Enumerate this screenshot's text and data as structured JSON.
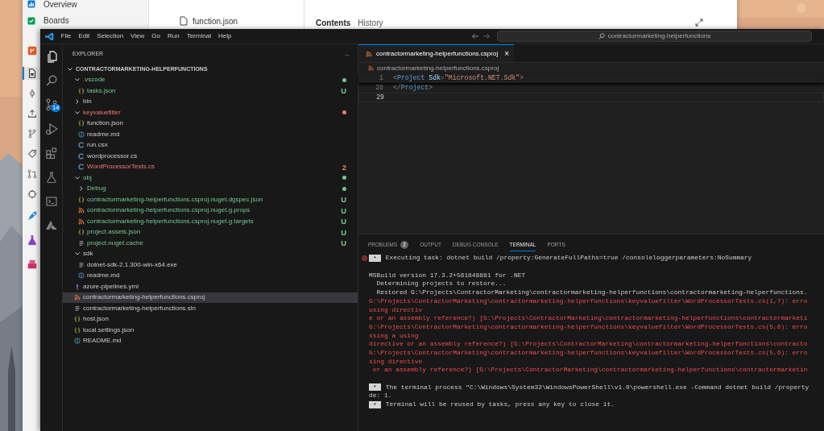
{
  "browser": {
    "nav": [
      {
        "kind": "overview",
        "label": "Overview",
        "selected": false
      },
      {
        "kind": "boards",
        "label": "Boards",
        "selected": false
      },
      {
        "kind": "repos",
        "selected": false
      },
      {
        "kind": "files",
        "selected": true
      },
      {
        "kind": "commits",
        "selected": false
      },
      {
        "kind": "pushes",
        "selected": false
      },
      {
        "kind": "branches",
        "selected": false
      },
      {
        "kind": "tags",
        "selected": false
      },
      {
        "kind": "pulls",
        "selected": false
      },
      {
        "kind": "advanced",
        "selected": false
      },
      {
        "kind": "pipelines",
        "selected": false
      },
      {
        "kind": "tests",
        "selected": false
      },
      {
        "kind": "artifacts",
        "selected": false
      }
    ],
    "file_tree": [
      {
        "name": "function.json"
      }
    ],
    "tabs": [
      {
        "label": "Contents",
        "selected": true
      },
      {
        "label": "History",
        "selected": false
      }
    ]
  },
  "editor": {
    "menu": [
      "File",
      "Edit",
      "Selection",
      "View",
      "Go",
      "Run",
      "Terminal",
      "Help"
    ],
    "command_center": "contractormarketing-helperfunctions",
    "activity_bar": [
      {
        "kind": "explorer",
        "selected": true
      },
      {
        "kind": "search",
        "selected": false
      },
      {
        "kind": "source-control",
        "badge": "14",
        "selected": false
      },
      {
        "kind": "run",
        "selected": false
      },
      {
        "kind": "extensions",
        "selected": false
      },
      {
        "kind": "testing",
        "selected": false
      },
      {
        "kind": "terminal",
        "selected": false
      },
      {
        "kind": "azure",
        "selected": false
      }
    ],
    "explorer": {
      "title": "EXPLORER",
      "more": "...",
      "root": {
        "name": "CONTRACTORMARKETING-HELPERFUNCTIONS",
        "expanded": true,
        "children": [
          {
            "name": ".vscode",
            "kind": "folder",
            "expanded": true,
            "color": "#73c991",
            "dot": true,
            "selected": false,
            "children": [
              {
                "name": "tasks.json",
                "kind": "json",
                "color": "#73c991",
                "decoration": "U",
                "selected": false
              }
            ]
          },
          {
            "name": "bin",
            "kind": "folder",
            "expanded": false,
            "dot": false,
            "selected": false
          },
          {
            "name": "keyvaluefilter",
            "kind": "folder",
            "expanded": true,
            "color": "#f07b6e",
            "dot": true,
            "selected": false,
            "children": [
              {
                "name": "function.json",
                "kind": "json",
                "selected": false
              },
              {
                "name": "readme.md",
                "kind": "info",
                "selected": false
              },
              {
                "name": "run.csx",
                "kind": "csharp",
                "selected": false
              },
              {
                "name": "wordprocessor.cs",
                "kind": "csharp",
                "selected": false
              },
              {
                "name": "WordProcessorTests.cs",
                "kind": "csharp",
                "color": "#f07b6e",
                "decoration": "2",
                "selected": false
              }
            ]
          },
          {
            "name": "obj",
            "kind": "folder",
            "expanded": true,
            "color": "#73c991",
            "dot": true,
            "selected": false,
            "children": [
              {
                "name": "Debug",
                "kind": "folder",
                "expanded": false,
                "color": "#73c991",
                "dot": true,
                "selected": false
              },
              {
                "name": "contractormarketing-helperfunctions.csproj.nuget.dgspec.json",
                "kind": "json",
                "color": "#73c991",
                "decoration": "U",
                "selected": false
              },
              {
                "name": "contractormarketing-helperfunctions.csproj.nuget.g.props",
                "kind": "rss",
                "color": "#73c991",
                "decoration": "U",
                "selected": false
              },
              {
                "name": "contractormarketing-helperfunctions.csproj.nuget.g.targets",
                "kind": "rss",
                "color": "#73c991",
                "decoration": "U",
                "selected": false
              },
              {
                "name": "project.assets.json",
                "kind": "json",
                "color": "#73c991",
                "decoration": "U",
                "selected": false
              },
              {
                "name": "project.nuget.cache",
                "kind": "lines",
                "color": "#73c991",
                "decoration": "U",
                "selected": false
              }
            ]
          },
          {
            "name": "sdk",
            "kind": "folder",
            "expanded": true,
            "dot": false,
            "selected": false,
            "children": [
              {
                "name": "dotnet-sdk-2.1.300-win-x64.exe",
                "kind": "lines",
                "selected": false
              },
              {
                "name": "readme.md",
                "kind": "info",
                "selected": false
              }
            ]
          },
          {
            "name": "azure-pipelines.yml",
            "kind": "yaml",
            "selected": false
          },
          {
            "name": "contractormarketing-helperfunctions.csproj",
            "kind": "rss",
            "selected": true
          },
          {
            "name": "contractormarketing-helperfunctions.sln",
            "kind": "lines",
            "selected": false
          },
          {
            "name": "host.json",
            "kind": "json",
            "selected": false
          },
          {
            "name": "local.settings.json",
            "kind": "json",
            "selected": false
          },
          {
            "name": "README.md",
            "kind": "info",
            "selected": false
          }
        ]
      }
    },
    "tabs": [
      {
        "label": "contractormarketing-helperfunctions.csproj",
        "kind": "rss",
        "close": "×",
        "selected": true
      }
    ],
    "breadcrumb": {
      "label": "contractormarketing-helperfunctions.csproj",
      "kind": "rss"
    },
    "code_lines": [
      {
        "number": "1",
        "sticky": true,
        "current": false,
        "tokens": [
          {
            "text": "<",
            "kind": "punct"
          },
          {
            "text": "Project",
            "kind": "tag"
          },
          {
            "text": " Sdk",
            "kind": "attr"
          },
          {
            "text": "=",
            "kind": "punct"
          },
          {
            "text": "\"Microsoft.NET.Sdk\"",
            "kind": "string"
          },
          {
            "text": ">",
            "kind": "punct"
          }
        ]
      },
      {
        "number": "28",
        "sticky": false,
        "current": false,
        "tokens": [
          {
            "text": "</",
            "kind": "punct"
          },
          {
            "text": "Project",
            "kind": "tag"
          },
          {
            "text": ">",
            "kind": "punct"
          }
        ]
      },
      {
        "number": "29",
        "sticky": false,
        "current": true
      }
    ],
    "panel": {
      "tabs": [
        {
          "label": "PROBLEMS",
          "badge": "2",
          "selected": false
        },
        {
          "label": "OUTPUT",
          "selected": false
        },
        {
          "label": "DEBUG CONSOLE",
          "selected": false
        },
        {
          "label": "TERMINAL",
          "selected": true
        },
        {
          "label": "PORTS",
          "selected": false
        }
      ],
      "terminal": [
        {
          "kind": "task",
          "failed": true,
          "marker": "*",
          "text": "Executing task: dotnet build /property:GenerateFullPaths=true /consoleloggerparameters:NoSummary"
        },
        {
          "kind": "blank"
        },
        {
          "kind": "plain",
          "text": "MSBuild version 17.3.2+561848881 for .NET"
        },
        {
          "kind": "plain",
          "text": "  Determining projects to restore..."
        },
        {
          "kind": "plain",
          "text": "  Restored G:\\Projects\\ContractorMarketing\\contractormarketing-helperfunctions\\contractormarketing-helperfunctions."
        },
        {
          "kind": "error",
          "text": "G:\\Projects\\ContractorMarketing\\contractormarketing-helperfunctions\\keyvaluefilter\\WordProcessorTests.cs(1,7): erro"
        },
        {
          "kind": "error",
          "text": "using directiv"
        },
        {
          "kind": "error",
          "text": "e or an assembly reference?) [G:\\Projects\\ContractorMarketing\\contractormarketing-helperfunctions\\contractormarketi"
        },
        {
          "kind": "error",
          "text": "G:\\Projects\\ContractorMarketing\\contractormarketing-helperfunctions\\keyvaluefilter\\WordProcessorTests.cs(5,6): erro"
        },
        {
          "kind": "error",
          "text": "ssing a using"
        },
        {
          "kind": "error",
          "text": "directive or an assembly reference?) [G:\\Projects\\ContractorMarketing\\contractormarketing-helperfunctions\\contracto"
        },
        {
          "kind": "error",
          "text": "G:\\Projects\\ContractorMarketing\\contractormarketing-helperfunctions\\keyvaluefilter\\WordProcessorTests.cs(5,6): erro"
        },
        {
          "kind": "error",
          "text": "sing directive"
        },
        {
          "kind": "error",
          "text": " or an assembly reference?) [G:\\Projects\\ContractorMarketing\\contractormarketing-helperfunctions\\contractormarketin"
        },
        {
          "kind": "blank"
        },
        {
          "kind": "task",
          "failed": false,
          "marker": "*",
          "text": "The terminal process \"C:\\Windows\\System32\\WindowsPowerShell\\v1.0\\powershell.exe -Command dotnet build /property"
        },
        {
          "kind": "plain",
          "text": "de: 1."
        },
        {
          "kind": "task",
          "failed": false,
          "marker": "*",
          "text": "Terminal will be reused by tasks, press any key to close it."
        }
      ]
    }
  }
}
